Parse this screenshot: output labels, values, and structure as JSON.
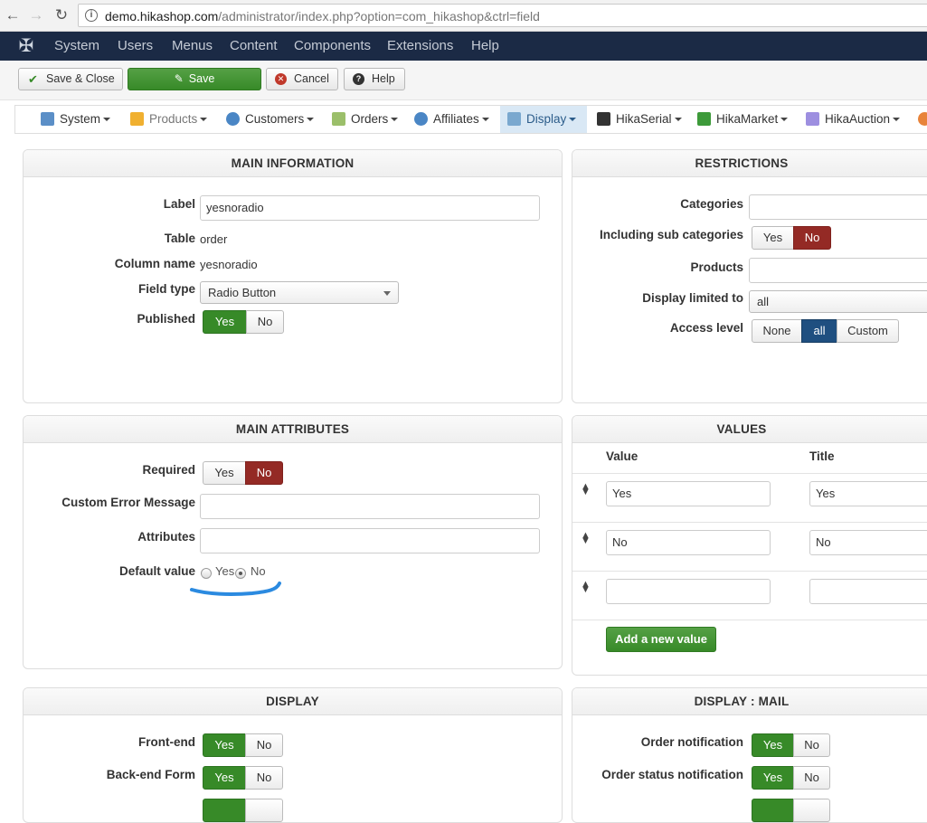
{
  "browser": {
    "url_host": "demo.hikashop.com",
    "url_path": "/administrator/index.php?option=com_hikashop&ctrl=field"
  },
  "topmenu": [
    "System",
    "Users",
    "Menus",
    "Content",
    "Components",
    "Extensions",
    "Help"
  ],
  "toolbar": {
    "save_close": "Save & Close",
    "save": "Save",
    "cancel": "Cancel",
    "help": "Help"
  },
  "hikamenu": [
    "System",
    "Products",
    "Customers",
    "Orders",
    "Affiliates",
    "Display",
    "HikaSerial",
    "HikaMarket",
    "HikaAuction"
  ],
  "main_info": {
    "title": "MAIN INFORMATION",
    "label_lbl": "Label",
    "label_val": "yesnoradio",
    "table_lbl": "Table",
    "table_val": "order",
    "column_lbl": "Column name",
    "column_val": "yesnoradio",
    "fieldtype_lbl": "Field type",
    "fieldtype_val": "Radio Button",
    "published_lbl": "Published"
  },
  "restrictions": {
    "title": "RESTRICTIONS",
    "categories_lbl": "Categories",
    "subcat_lbl": "Including sub categories",
    "products_lbl": "Products",
    "display_limited_lbl": "Display limited to",
    "display_limited_val": "all",
    "access_lbl": "Access level"
  },
  "main_attr": {
    "title": "MAIN ATTRIBUTES",
    "required_lbl": "Required",
    "error_lbl": "Custom Error Message",
    "attributes_lbl": "Attributes",
    "default_lbl": "Default value",
    "default_yes": "Yes",
    "default_no": "No"
  },
  "values": {
    "title": "VALUES",
    "col_value": "Value",
    "col_title": "Title",
    "rows": [
      {
        "value": "Yes",
        "title": "Yes"
      },
      {
        "value": "No",
        "title": "No"
      },
      {
        "value": "",
        "title": ""
      }
    ],
    "add_label": "Add a new value"
  },
  "display": {
    "title": "DISPLAY",
    "frontend_lbl": "Front-end",
    "backend_form_lbl": "Back-end Form"
  },
  "display_mail": {
    "title": "DISPLAY : MAIL",
    "order_notif_lbl": "Order notification",
    "order_status_lbl": "Order status notification"
  },
  "toggle": {
    "yes": "Yes",
    "no": "No",
    "none": "None",
    "all": "all",
    "custom": "Custom"
  }
}
